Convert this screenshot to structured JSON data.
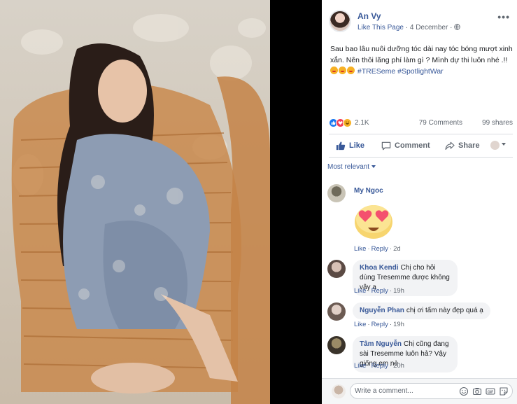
{
  "post": {
    "author": "An Vy",
    "like_page": "Like This Page",
    "separator": " · ",
    "date": "4 December",
    "dot": " · ",
    "text": "Sau bao lâu nuôi dưỡng tóc dài nay tóc bóng mượt xinh xắn. Nên thôi lãng phí làm gì ? Mình dự thi luôn nhé .!! ",
    "hashtag_1": "#TRESeme",
    "hashtag_2": "#SpotlightWar",
    "reaction_count": "2.1K",
    "comments_count": "79 Comments",
    "shares_count": "99 shares"
  },
  "actions": {
    "like": "Like",
    "comment": "Comment",
    "share": "Share"
  },
  "sort_label": "Most relevant",
  "comments": [
    {
      "name": "My Ngoc",
      "text": "",
      "like": "Like",
      "reply": "Reply",
      "time": "2d",
      "sticker": "heart-eyes"
    },
    {
      "name": "Khoa Kendi",
      "text": "Chị cho hỏi dùng Tresemme được không vậy ạ",
      "like": "Like",
      "reply": "Reply",
      "time": "19h"
    },
    {
      "name": "Nguyễn Phan",
      "text": "chị ơi tấm này đẹp quá ạ",
      "like": "Like",
      "reply": "Reply",
      "time": "19h"
    },
    {
      "name": "Tâm Nguyễn",
      "text": "Chị cũng đang sài Tresemme luôn hả? Vậy giống em nè",
      "like": "Like",
      "reply": "Reply",
      "time": "20h"
    }
  ],
  "composer": {
    "placeholder": "Write a comment..."
  },
  "colors": {
    "link": "#385898",
    "muted": "#606770",
    "bubble": "#f2f3f5",
    "like_blue": "#1877f2"
  }
}
